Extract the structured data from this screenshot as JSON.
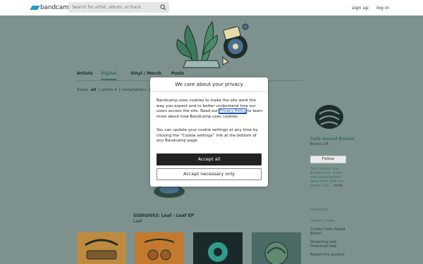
{
  "header": {
    "logo_text": "bandcamp",
    "search_placeholder": "Search for artist, album, or track",
    "signup_label": "sign up",
    "login_label": "log in"
  },
  "tabs": [
    {
      "label": "Artists"
    },
    {
      "label": "Digital"
    },
    {
      "label": "Vinyl / Merch"
    },
    {
      "label": "Posts"
    }
  ],
  "filter": {
    "show_label": "Show:",
    "all_label": "all",
    "artists_label": "artists",
    "compilations_label": "compilations, et"
  },
  "featured": {
    "title": "SSDIGI053: Leaf - Leaf EP",
    "artist": "Leaf"
  },
  "sidebar": {
    "name": "Sofa Sound Bristol",
    "location": "Bristol, UK",
    "follow_label": "Follow",
    "bio": "Sofa Sound, the Bristol-born, bred and based record label from DnB has grown into...",
    "more_label": "more",
    "instagram_label": "Instagram",
    "contact_help_label": "contact / help",
    "contact_label": "Contact Sofa Sound Bristol",
    "streaming_label": "Streaming and Download help",
    "report_label": "Report this account"
  },
  "modal": {
    "title": "We care about your privacy",
    "p1_before": "Bandcamp uses cookies to make the site work the way you expect and to better understand how our users access the site. Read our ",
    "policy_link": "Privacy Policy",
    "p1_after": " to learn more about how Bandcamp uses cookies.",
    "p2": "You can update your cookie settings at any time by clicking the “Cookie settings” link at the bottom of any Bandcamp page.",
    "accept_all_label": "Accept all",
    "accept_necessary_label": "Accept necessary only"
  },
  "colors": {
    "page_background": "#7d928f",
    "accent": "#3f6e5c",
    "logo_blue": "#1da0c3",
    "accept_button": "#222222"
  }
}
